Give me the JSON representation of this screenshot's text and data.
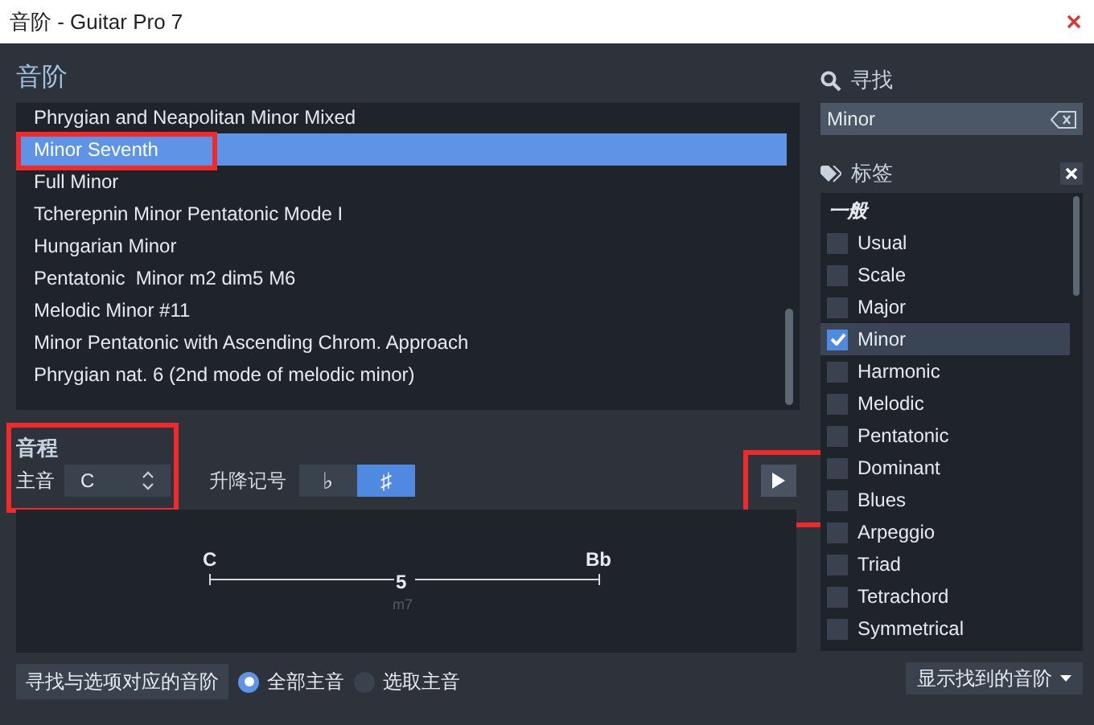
{
  "window": {
    "title": "音阶 - Guitar Pro 7"
  },
  "scales": {
    "heading": "音阶",
    "items": [
      {
        "label": "Phrygian and Neapolitan Minor Mixed",
        "selected": false,
        "highlighted": false
      },
      {
        "label": "Minor Seventh",
        "selected": true,
        "highlighted": true
      },
      {
        "label": "Full Minor",
        "selected": false,
        "highlighted": false
      },
      {
        "label": "Tcherepnin Minor Pentatonic Mode I",
        "selected": false,
        "highlighted": false
      },
      {
        "label": "Hungarian Minor",
        "selected": false,
        "highlighted": false
      },
      {
        "label": "Pentatonic  Minor m2 dim5 M6",
        "selected": false,
        "highlighted": false
      },
      {
        "label": "Melodic Minor #11",
        "selected": false,
        "highlighted": false
      },
      {
        "label": "Minor Pentatonic with Ascending Chrom. Approach",
        "selected": false,
        "highlighted": false
      },
      {
        "label": "Phrygian nat. 6 (2nd mode of melodic minor)",
        "selected": false,
        "highlighted": false
      }
    ]
  },
  "intervals": {
    "heading": "音程",
    "tonic_label": "主音",
    "tonic_value": "C",
    "tonic_highlighted": true,
    "accidentals_label": "升降记号",
    "accidentals": [
      {
        "label": "♭",
        "selected": false
      },
      {
        "label": "♯",
        "selected": true
      }
    ],
    "play_highlighted": true,
    "diagram": {
      "start_note": "C",
      "end_note": "Bb",
      "interval": "5",
      "interval_name": "m7"
    }
  },
  "bottom": {
    "find_button": "寻找与选项对应的音阶",
    "radios": [
      {
        "label": "全部主音",
        "selected": true
      },
      {
        "label": "选取主音",
        "selected": false
      }
    ],
    "show_button": "显示找到的音阶"
  },
  "search": {
    "heading": "寻找",
    "value": "Minor"
  },
  "tags": {
    "heading": "标签",
    "items": [
      {
        "kind": "header",
        "label": "一般"
      },
      {
        "kind": "tag",
        "label": "Usual",
        "checked": false,
        "selected": false
      },
      {
        "kind": "tag",
        "label": "Scale",
        "checked": false,
        "selected": false
      },
      {
        "kind": "tag",
        "label": "Major",
        "checked": false,
        "selected": false
      },
      {
        "kind": "tag",
        "label": "Minor",
        "checked": true,
        "selected": true
      },
      {
        "kind": "tag",
        "label": "Harmonic",
        "checked": false,
        "selected": false
      },
      {
        "kind": "tag",
        "label": "Melodic",
        "checked": false,
        "selected": false
      },
      {
        "kind": "tag",
        "label": "Pentatonic",
        "checked": false,
        "selected": false
      },
      {
        "kind": "tag",
        "label": "Dominant",
        "checked": false,
        "selected": false
      },
      {
        "kind": "tag",
        "label": "Blues",
        "checked": false,
        "selected": false
      },
      {
        "kind": "tag",
        "label": "Arpeggio",
        "checked": false,
        "selected": false
      },
      {
        "kind": "tag",
        "label": "Triad",
        "checked": false,
        "selected": false
      },
      {
        "kind": "tag",
        "label": "Tetrachord",
        "checked": false,
        "selected": false
      },
      {
        "kind": "tag",
        "label": "Symmetrical",
        "checked": false,
        "selected": false
      }
    ]
  }
}
